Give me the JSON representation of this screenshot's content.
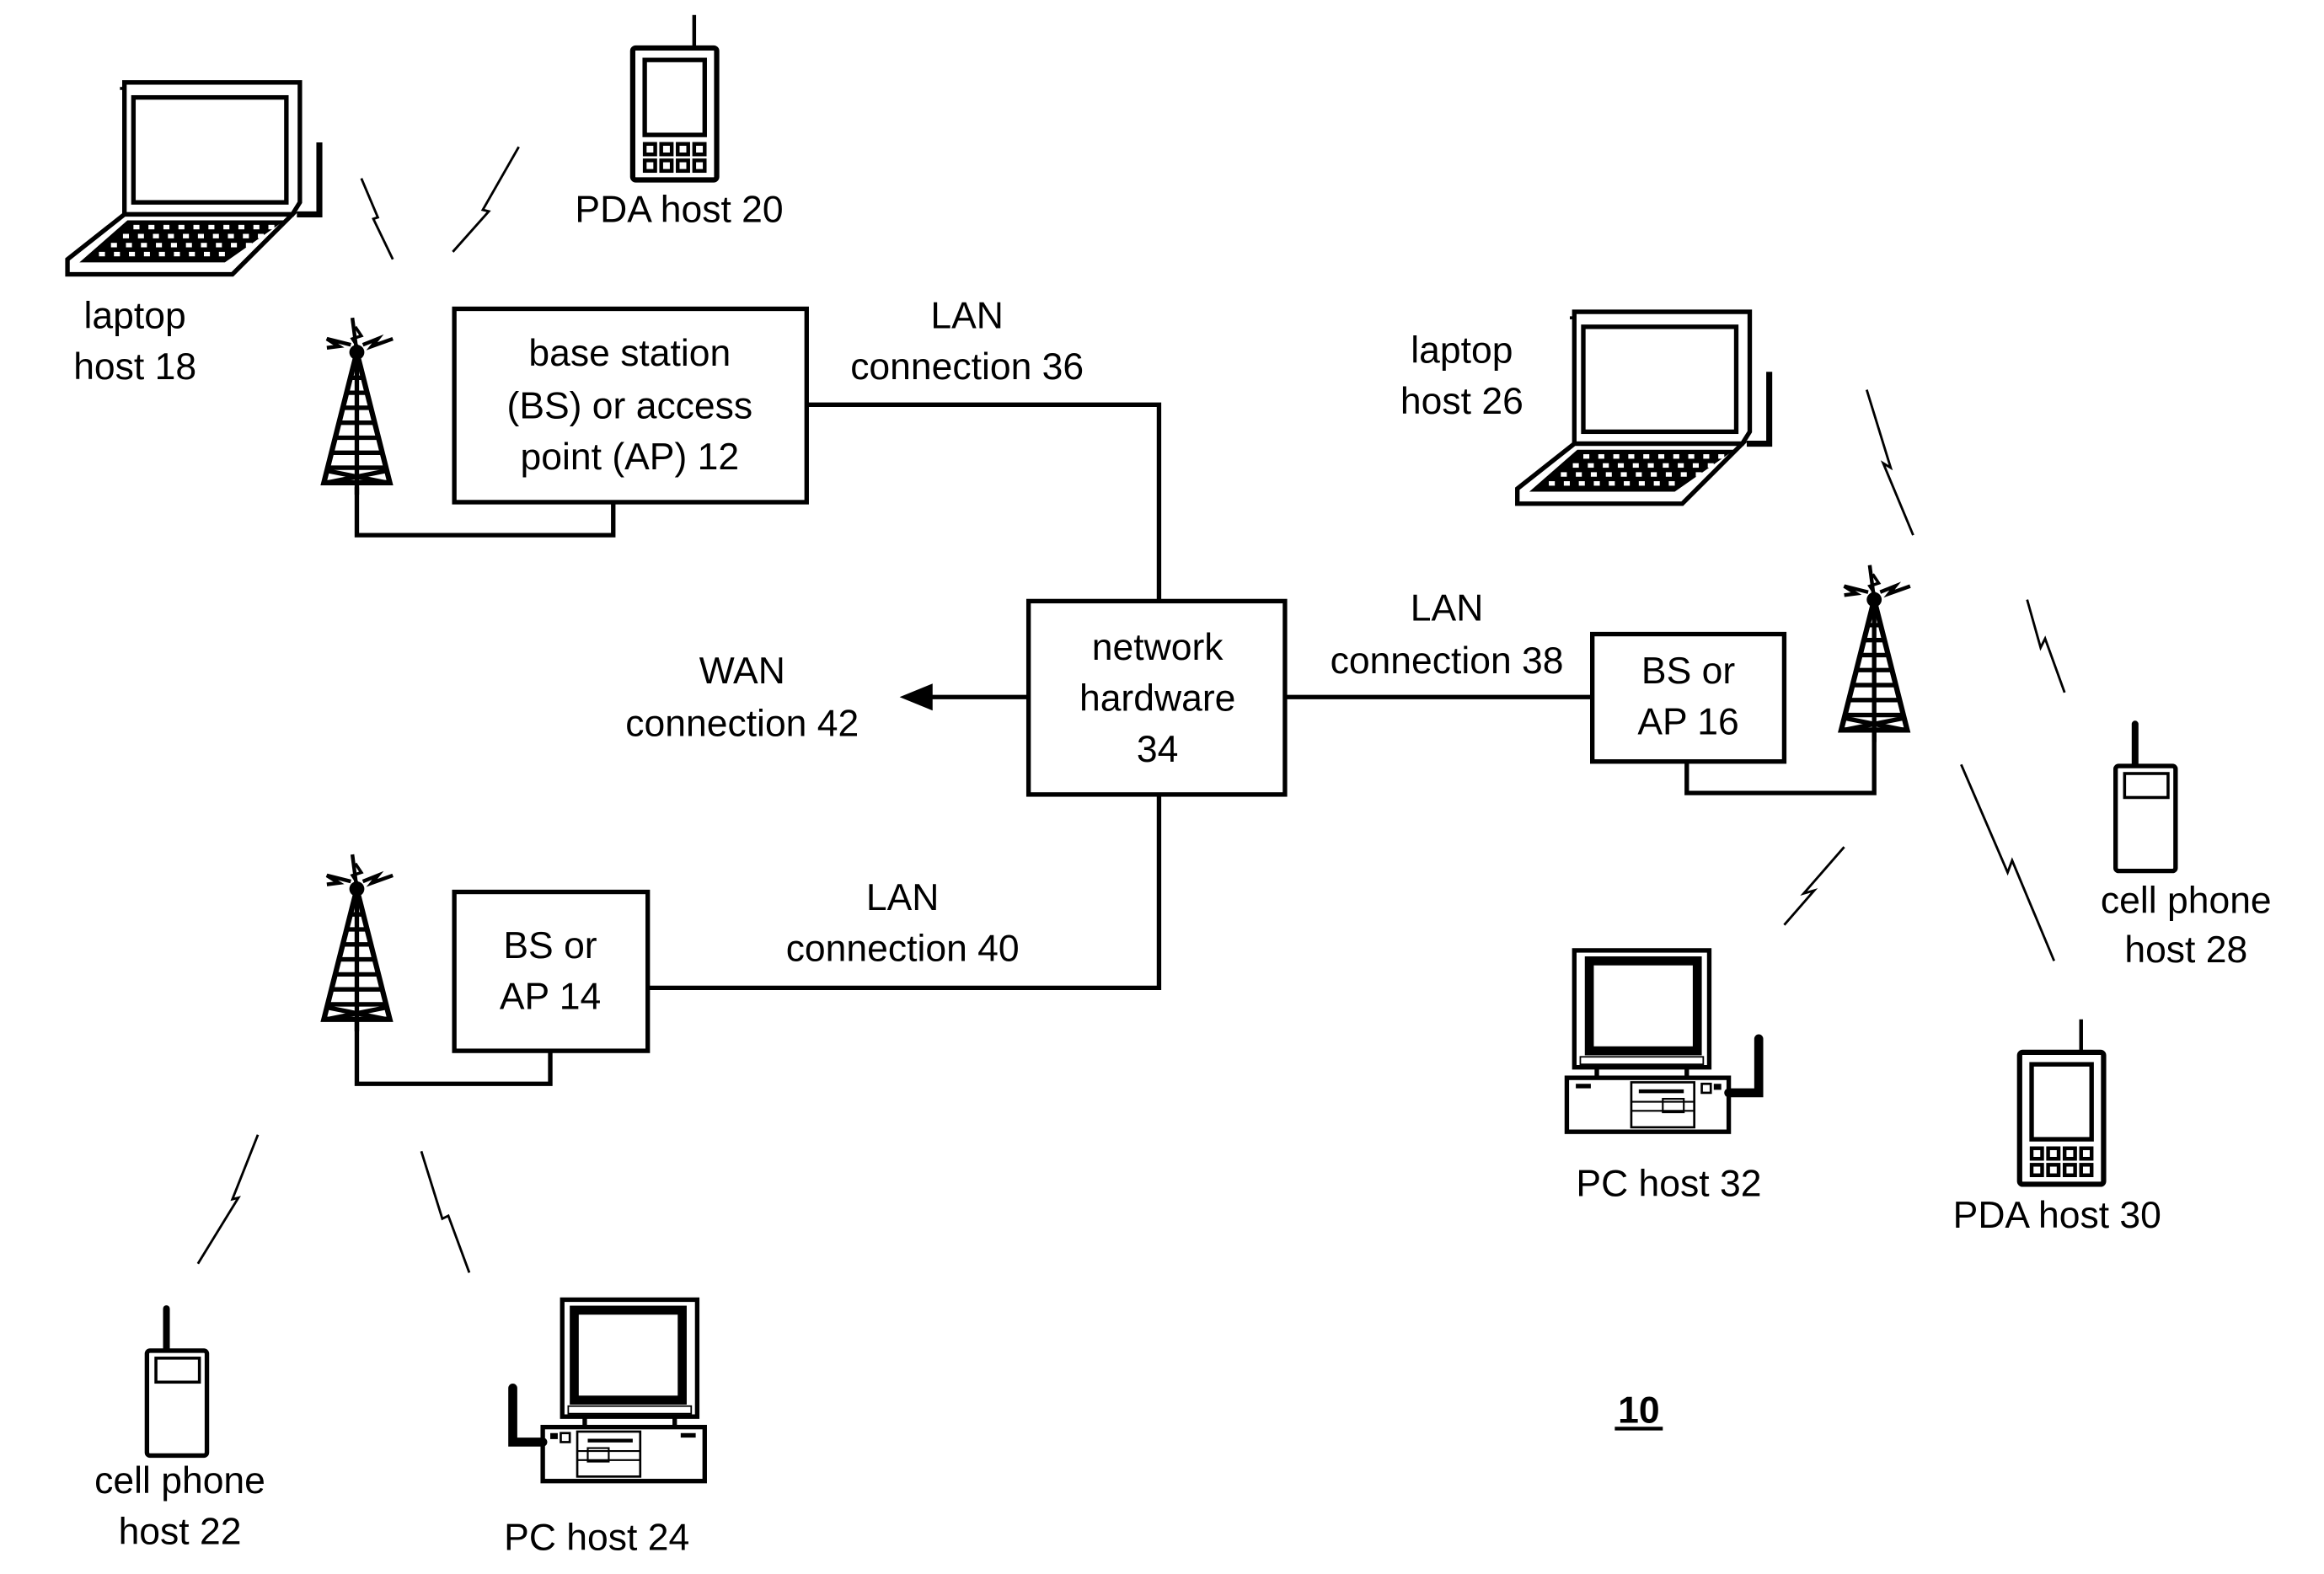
{
  "figure": {
    "reference_number": "10",
    "nodes": {
      "bs12": {
        "lines": [
          "base station",
          "(BS) or access",
          "point (AP) 12"
        ]
      },
      "bs14": {
        "lines": [
          "BS or",
          "AP 14"
        ]
      },
      "bs16": {
        "lines": [
          "BS or",
          "AP 16"
        ]
      },
      "network_hardware": {
        "lines": [
          "network",
          "hardware",
          "34"
        ]
      }
    },
    "connections": {
      "lan36": [
        "LAN",
        "connection 36"
      ],
      "lan38": [
        "LAN",
        "connection 38"
      ],
      "lan40": [
        "LAN",
        "connection 40"
      ],
      "wan42": [
        "WAN",
        "connection 42"
      ]
    },
    "hosts": {
      "laptop18": [
        "laptop",
        "host 18"
      ],
      "pda20": [
        "PDA host 20"
      ],
      "cell22": [
        "cell phone",
        "host 22"
      ],
      "pc24": [
        "PC host 24"
      ],
      "laptop26": [
        "laptop",
        "host 26"
      ],
      "cell28": [
        "cell phone",
        "host 28"
      ],
      "pda30": [
        "PDA host 30"
      ],
      "pc32": [
        "PC host 32"
      ]
    },
    "icons": {
      "tower": "radio-tower-icon",
      "laptop": "laptop-icon",
      "pda": "pda-icon",
      "cellphone": "cell-phone-icon",
      "pc": "desktop-pc-icon",
      "wireless_link": "lightning-bolt-icon"
    }
  }
}
